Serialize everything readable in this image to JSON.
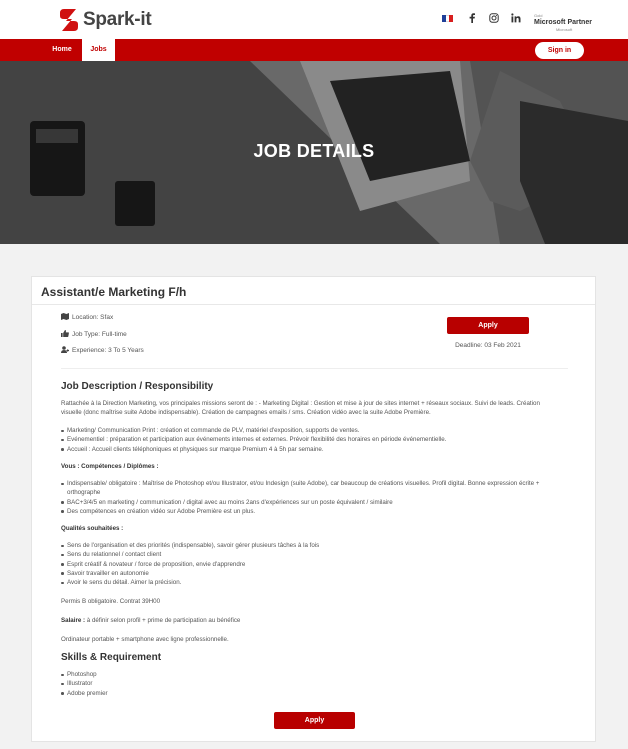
{
  "brand": {
    "name": "Spark-it",
    "color": "#c00000"
  },
  "header": {
    "social": [
      "facebook-icon",
      "instagram-icon",
      "linkedin-icon"
    ],
    "partner": {
      "top": "Gold",
      "main": "Microsoft Partner",
      "sub": "Microsoft"
    }
  },
  "nav": {
    "items": [
      {
        "label": "Home"
      },
      {
        "label": "Jobs"
      }
    ],
    "signin": "Sign in"
  },
  "hero": {
    "title": "JOB DETAILS"
  },
  "job": {
    "title": "Assistant/e Marketing F/h",
    "location": "Location: Sfax",
    "type": "Job Type: Full-time",
    "experience": "Experience: 3 To 5 Years",
    "apply": "Apply",
    "deadline": "Deadline: 03 Feb 2021"
  },
  "description": {
    "heading": "Job Description / Responsibility",
    "intro": "Rattachée à la Direction Marketing, vos principales missions seront de : - Marketing Digital : Gestion et mise à jour de sites internet + réseaux sociaux. Suivi de leads. Création visuelle (donc maîtrise suite Adobe indispensable). Création de campagnes emails / sms. Création vidéo avec la suite Adobe Première.",
    "missions": [
      "Marketing/ Communication Print : création et commande de PLV, matériel d'exposition, supports de ventes.",
      "Evénementiel : préparation et participation aux événements internes et externes. Prévoir flexibilité des horaires en période événementielle.",
      "Accueil : Accueil clients téléphoniques et physiques sur marque Premium 4 à 5h par semaine."
    ],
    "competences_title": "Vous : Compétences / Diplômes :",
    "competences": [
      "Indispensable/ obligatoire : Maîtrise de Photoshop et/ou Illustrator, et/ou Indesign (suite Adobe), car beaucoup de créations visuelles. Profil digital. Bonne expression écrite + orthographe",
      "BAC+3/4/5 en marketing / communication / digital avec au moins 2ans d'expériences sur un poste équivalent / similaire",
      "Des compétences en création vidéo sur Adobe Première est un plus."
    ],
    "qualites_title": "Qualités souhaitées :",
    "qualites": [
      "Sens de l'organisation et des priorités (indispensable), savoir gérer plusieurs tâches à la fois",
      "Sens du relationnel / contact client",
      "Esprit créatif & novateur / force de proposition, envie d'apprendre",
      "Savoir travailler en autonomie",
      "Avoir le sens du détail. Aimer la précision."
    ],
    "permis": "Permis B obligatoire. Contrat 39H00",
    "salaire_label": "Salaire :",
    "salaire_value": " à définir selon profil + prime de participation au bénéfice",
    "ordinateur": "Ordinateur portable + smartphone avec ligne professionnelle."
  },
  "skills": {
    "heading": "Skills & Requirement",
    "items": [
      "Photoshop",
      "Illustrator",
      "Adobe premier"
    ]
  },
  "apply_bottom": "Apply"
}
